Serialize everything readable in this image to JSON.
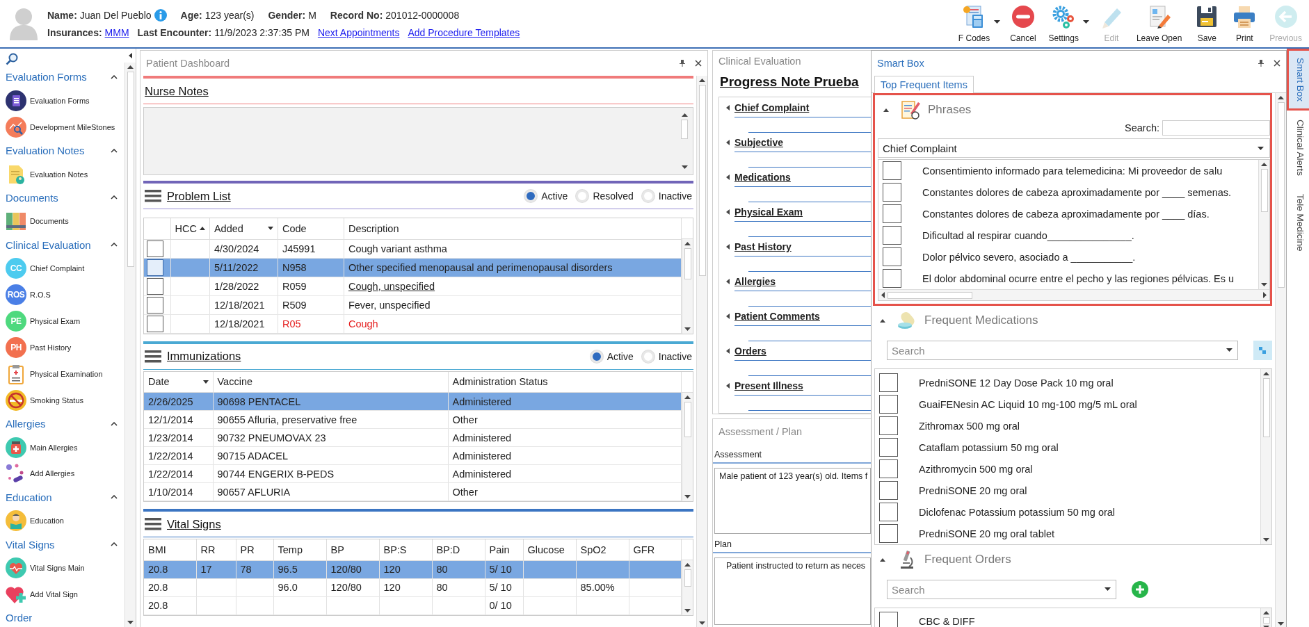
{
  "patient": {
    "name_label": "Name:",
    "name": "Juan Del Pueblo",
    "info": true,
    "age_label": "Age:",
    "age": "123 year(s)",
    "gender_label": "Gender:",
    "gender": "M",
    "record_label": "Record No:",
    "record_no": "201012-0000008",
    "insurances_label": "Insurances:",
    "insurance": "MMM",
    "last_encounter_label": "Last Encounter:",
    "last_encounter": "11/9/2023 2:37:35 PM",
    "links": [
      "Next Appointments",
      "Add Procedure Templates"
    ]
  },
  "toolbar": [
    {
      "label": "F Codes",
      "dropdown": true,
      "disabled": false
    },
    {
      "label": "Cancel",
      "dropdown": false,
      "disabled": false
    },
    {
      "label": "Settings",
      "dropdown": true,
      "disabled": false
    },
    {
      "label": "Edit",
      "dropdown": false,
      "disabled": true
    },
    {
      "label": "Leave Open",
      "dropdown": false,
      "disabled": false
    },
    {
      "label": "Save",
      "dropdown": false,
      "disabled": false
    },
    {
      "label": "Print",
      "dropdown": false,
      "disabled": false
    },
    {
      "label": "Previous",
      "dropdown": false,
      "disabled": true
    }
  ],
  "sidebar": {
    "groups": [
      {
        "title": "Evaluation Forms",
        "expanded": true,
        "items": [
          {
            "label": "Evaluation Forms"
          },
          {
            "label": "Development MileStones"
          }
        ]
      },
      {
        "title": "Evaluation Notes",
        "expanded": true,
        "items": [
          {
            "label": "Evaluation Notes"
          }
        ]
      },
      {
        "title": "Documents",
        "expanded": true,
        "items": [
          {
            "label": "Documents"
          }
        ]
      },
      {
        "title": "Clinical Evaluation",
        "expanded": true,
        "items": [
          {
            "label": "Chief Complaint",
            "badge": "CC",
            "color": "#4dcbef"
          },
          {
            "label": "R.O.S",
            "badge": "ROS",
            "color": "#4a7fe6"
          },
          {
            "label": "Physical Exam",
            "badge": "PE",
            "color": "#4ed97e"
          },
          {
            "label": "Past History",
            "badge": "PH",
            "color": "#f2704f"
          },
          {
            "label": "Physical Examination"
          },
          {
            "label": "Smoking Status"
          }
        ]
      },
      {
        "title": "Allergies",
        "expanded": true,
        "items": [
          {
            "label": "Main Allergies"
          },
          {
            "label": "Add Allergies"
          }
        ]
      },
      {
        "title": "Education",
        "expanded": true,
        "items": [
          {
            "label": "Education"
          }
        ]
      },
      {
        "title": "Vital Signs",
        "expanded": true,
        "items": [
          {
            "label": "Vital Signs Main"
          },
          {
            "label": "Add Vital Sign"
          }
        ]
      },
      {
        "title": "Order"
      }
    ]
  },
  "dashboard": {
    "title": "Patient Dashboard",
    "nurse_notes": {
      "title": "Nurse Notes"
    },
    "problem_list": {
      "title": "Problem List",
      "filters": [
        {
          "label": "Active",
          "selected": true
        },
        {
          "label": "Resolved",
          "selected": false
        },
        {
          "label": "Inactive",
          "selected": false
        }
      ],
      "columns": [
        {
          "label": "HCC",
          "sorted": true,
          "ascending": true
        },
        {
          "label": "Added",
          "sorted": true,
          "ascending": false
        },
        {
          "label": "Code",
          "sorted": false
        },
        {
          "label": "Description",
          "sorted": false
        }
      ],
      "rows": [
        {
          "checked": false,
          "selected": false,
          "added": "4/30/2024",
          "code": "J45991",
          "description": "Cough variant asthma",
          "underlined": false,
          "alert": false
        },
        {
          "checked": false,
          "selected": true,
          "added": "5/11/2022",
          "code": "N958",
          "description": "Other specified menopausal and perimenopausal disorders",
          "underlined": false,
          "alert": false
        },
        {
          "checked": false,
          "selected": false,
          "added": "1/28/2022",
          "code": "R059",
          "description": "Cough, unspecified",
          "underlined": true,
          "alert": false
        },
        {
          "checked": false,
          "selected": false,
          "added": "12/18/2021",
          "code": "R509",
          "description": "Fever, unspecified",
          "underlined": false,
          "alert": false
        },
        {
          "checked": false,
          "selected": false,
          "added": "12/18/2021",
          "code": "R05",
          "description": "Cough",
          "underlined": false,
          "alert": true
        }
      ]
    },
    "immunizations": {
      "title": "Immunizations",
      "filters": [
        {
          "label": "Active",
          "selected": true
        },
        {
          "label": "Inactive",
          "selected": false
        }
      ],
      "columns": [
        {
          "label": "Date",
          "sorted": true,
          "ascending": false
        },
        {
          "label": "Vaccine",
          "sorted": false
        },
        {
          "label": "Administration Status",
          "sorted": false
        }
      ],
      "rows": [
        {
          "selected": true,
          "cells": [
            "2/26/2025",
            "90698 PENTACEL",
            "Administered"
          ]
        },
        {
          "selected": false,
          "cells": [
            "12/1/2014",
            "90655 Afluria, preservative free",
            "Other"
          ]
        },
        {
          "selected": false,
          "cells": [
            "1/23/2014",
            "90732 PNEUMOVAX 23",
            "Administered"
          ]
        },
        {
          "selected": false,
          "cells": [
            "1/22/2014",
            "90715 ADACEL",
            "Administered"
          ]
        },
        {
          "selected": false,
          "cells": [
            "1/22/2014",
            "90744 ENGERIX B-PEDS",
            "Administered"
          ]
        },
        {
          "selected": false,
          "cells": [
            "1/10/2014",
            "90657 AFLURIA",
            "Other"
          ]
        }
      ]
    },
    "vital_signs": {
      "title": "Vital Signs",
      "columns": [
        "BMI",
        "RR",
        "PR",
        "Temp",
        "BP",
        "BP:S",
        "BP:D",
        "Pain",
        "Glucose",
        "SpO2",
        "GFR"
      ],
      "rows": [
        {
          "selected": true,
          "cells": [
            "20.8",
            "17",
            "78",
            "96.5",
            "120/80",
            "120",
            "80",
            "5/ 10",
            null,
            null,
            null
          ]
        },
        {
          "selected": false,
          "cells": [
            "20.8",
            null,
            null,
            "96.0",
            "120/80",
            "120",
            "80",
            "5/ 10",
            null,
            "85.00%",
            null
          ]
        },
        {
          "selected": false,
          "cells": [
            "20.8",
            null,
            null,
            null,
            null,
            null,
            null,
            "0/ 10",
            null,
            null,
            null
          ]
        }
      ]
    }
  },
  "clinical_evaluation": {
    "title": "Clinical Evaluation",
    "note_title": "Progress Note Prueba",
    "sections": [
      {
        "label": "Chief Complaint",
        "expanded": true
      },
      {
        "label": "Subjective",
        "expanded": true
      },
      {
        "label": "Medications",
        "expanded": true
      },
      {
        "label": "Physical Exam",
        "expanded": true
      },
      {
        "label": "Past History",
        "expanded": true
      },
      {
        "label": "Allergies",
        "expanded": true
      },
      {
        "label": "Patient Comments",
        "expanded": true
      },
      {
        "label": "Orders",
        "expanded": true
      },
      {
        "label": "Present Illness",
        "expanded": true
      }
    ]
  },
  "assessment_plan": {
    "title": "Assessment / Plan",
    "assessment_label": "Assessment",
    "assessment_text": "Male patient of 123 year(s) old. Items f",
    "plan_label": "Plan",
    "plan_text": "Patient instructed to return as neces"
  },
  "smart_box": {
    "title": "Smart Box",
    "tabs": [
      {
        "label": "Top Frequent Items",
        "selected": true
      }
    ],
    "phrases": {
      "title": "Phrases",
      "expanded": true,
      "highlighted": true,
      "search_label": "Search:",
      "category": "Chief Complaint",
      "items": [
        {
          "text": "Consentimiento informado para telemedicina:  Mi proveedor de salu",
          "checked": false
        },
        {
          "text": "Constantes dolores de cabeza aproximadamente por ____ semenas.",
          "checked": false
        },
        {
          "text": "Constantes dolores de cabeza aproximadamente por ____ días.",
          "checked": false
        },
        {
          "text": "Dificultad al respirar cuando_______________.",
          "checked": false
        },
        {
          "text": "Dolor pélvico severo, asociado a ___________.",
          "checked": false
        },
        {
          "text": "El dolor abdominal ocurre entre el pecho y las regiones pélvicas. Es u",
          "checked": false
        }
      ]
    },
    "medications": {
      "title": "Frequent Medications",
      "expanded": true,
      "placeholder": "Search",
      "items": [
        {
          "text": "PredniSONE 12 Day Dose Pack 10 mg oral",
          "checked": false
        },
        {
          "text": "GuaiFENesin AC Liquid 10 mg-100 mg/5 mL oral",
          "checked": false
        },
        {
          "text": "Zithromax 500 mg oral",
          "checked": false
        },
        {
          "text": "Cataflam potassium 50 mg oral",
          "checked": false
        },
        {
          "text": "Azithromycin 500 mg oral",
          "checked": false
        },
        {
          "text": "PredniSONE 20 mg oral",
          "checked": false
        },
        {
          "text": "Diclofenac Potassium potassium 50 mg oral",
          "checked": false
        },
        {
          "text": "PredniSONE 20 mg oral tablet",
          "checked": false
        }
      ]
    },
    "orders": {
      "title": "Frequent Orders",
      "expanded": true,
      "placeholder": "Search",
      "items": [
        {
          "text": "CBC & DIFF",
          "checked": false
        }
      ]
    }
  },
  "side_tabs": [
    {
      "label": "Smart Box",
      "selected": true,
      "highlighted": true
    },
    {
      "label": "Clinical Alerts",
      "selected": false,
      "highlighted": false
    },
    {
      "label": "Tele Medicine",
      "selected": false,
      "highlighted": false
    }
  ]
}
